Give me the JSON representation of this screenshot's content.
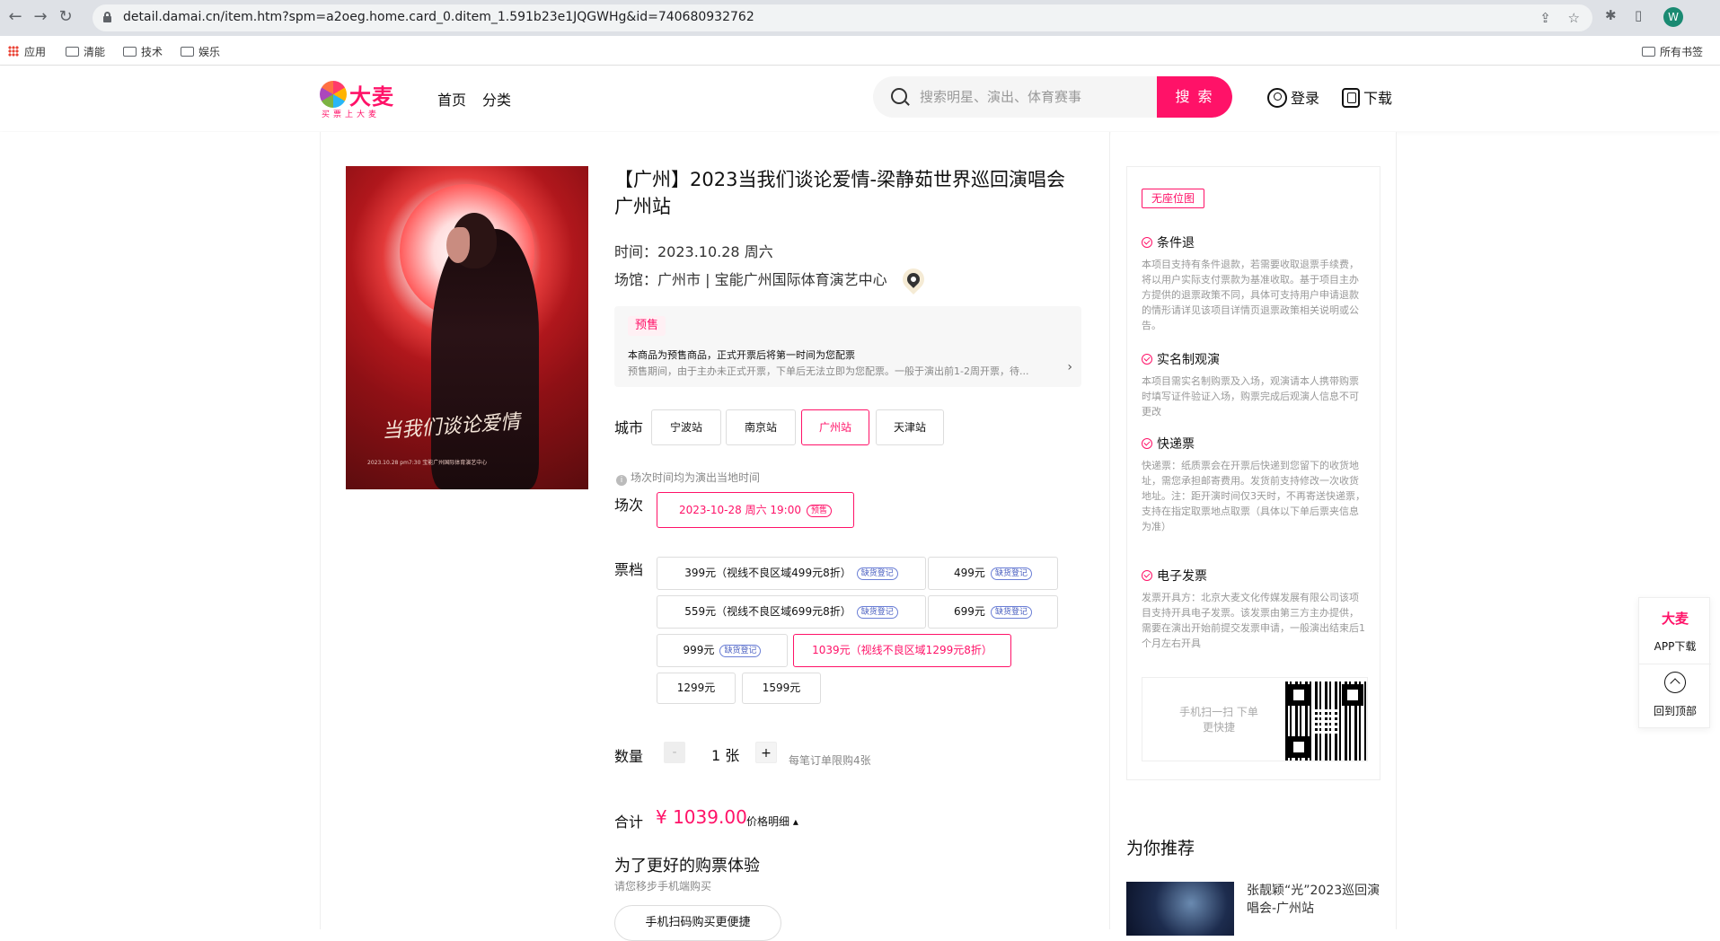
{
  "browser": {
    "url": "detail.damai.cn/item.htm?spm=a2oeg.home.card_0.ditem_1.591b23e1JQGWHg&id=740680932762",
    "avatar_letter": "W",
    "bookmarks": [
      "应用",
      "清能",
      "技术",
      "娱乐"
    ],
    "all_bookmarks": "所有书签"
  },
  "header": {
    "logo_text": "大麦",
    "logo_sub": "买票上大麦",
    "nav": [
      "首页",
      "分类"
    ],
    "search_placeholder": "搜索明星、演出、体育赛事",
    "search_button": "搜 索",
    "login": "登录",
    "download": "下载"
  },
  "event": {
    "title": "【广州】2023当我们谈论爱情-梁静茹世界巡回演唱会广州站",
    "time": "时间：2023.10.28 周六",
    "venue": "场馆：广州市 | 宝能广州国际体育演艺中心",
    "poster_title": "当我们谈论爱情",
    "poster_small": "2023.10.28   pm7:30   宝能广州国际体育演艺中心"
  },
  "presale": {
    "tag": "预售",
    "main": "本商品为预售商品，正式开票后将第一时间为您配票",
    "sub": "预售期间，由于主办未正式开票，下单后无法立即为您配票。一般于演出前1-2周开票，待...",
    "arrow": "›"
  },
  "city": {
    "label": "城市",
    "options": [
      "宁波站",
      "南京站",
      "广州站",
      "天津站"
    ],
    "selected": "广州站"
  },
  "session": {
    "note": "场次时间均为演出当地时间",
    "label": "场次",
    "value": "2023-10-28 周六 19:00",
    "badge": "预售"
  },
  "tickets": {
    "label": "票档",
    "badge_text": "缺货登记",
    "items": [
      {
        "text": "399元（视线不良区域499元8折）",
        "badge": true
      },
      {
        "text": "499元",
        "badge": true
      },
      {
        "text": "559元（视线不良区域699元8折）",
        "badge": true
      },
      {
        "text": "699元",
        "badge": true
      },
      {
        "text": "999元",
        "badge": true
      },
      {
        "text": "1039元（视线不良区域1299元8折）",
        "badge": false,
        "selected": true
      },
      {
        "text": "1299元",
        "badge": false
      },
      {
        "text": "1599元",
        "badge": false
      }
    ]
  },
  "quantity": {
    "label": "数量",
    "minus": "-",
    "value": "1 张",
    "plus": "+",
    "limit_note": "每笔订单限购4张"
  },
  "total": {
    "label": "合计",
    "price": "¥ 1039.00",
    "detail": "价格明细 ▴"
  },
  "mobile": {
    "title": "为了更好的购票体验",
    "sub": "请您移步手机端购买",
    "button": "手机扫码购买更便捷"
  },
  "policy": {
    "no_seat_map": "无座位图",
    "sections": [
      {
        "title": "条件退",
        "text": "本项目支持有条件退款，若需要收取退票手续费，将以用户实际支付票款为基准收取。基于项目主办方提供的退票政策不同，具体可支持用户申请退款的情形请详见该项目详情页退票政策相关说明或公告。"
      },
      {
        "title": "实名制观演",
        "text": "本项目需实名制购票及入场，观演请本人携带购票时填写证件验证入场，购票完成后观演人信息不可更改"
      },
      {
        "title": "快递票",
        "text": "快递票：纸质票会在开票后快递到您留下的收货地址，需您承担邮寄费用。发货前支持修改一次收货地址。注：距开演时间仅3天时，不再寄送快递票，支持在指定取票地点取票（具体以下单后票夹信息为准）"
      },
      {
        "title": "电子发票",
        "text": "发票开具方：北京大麦文化传媒发展有限公司该项目支持开具电子发票。该发票由第三方主办提供，需要在演出开始前提交发票申请，一般演出结束后1个月左右开具"
      }
    ],
    "qr_text": "手机扫一扫 下单更快捷"
  },
  "recommend": {
    "title": "为你推荐",
    "item_name": "张靓颖“光”2023巡回演唱会-广州站"
  },
  "float": {
    "logo": "大麦",
    "app_download": "APP下载",
    "back_top": "回到顶部"
  }
}
